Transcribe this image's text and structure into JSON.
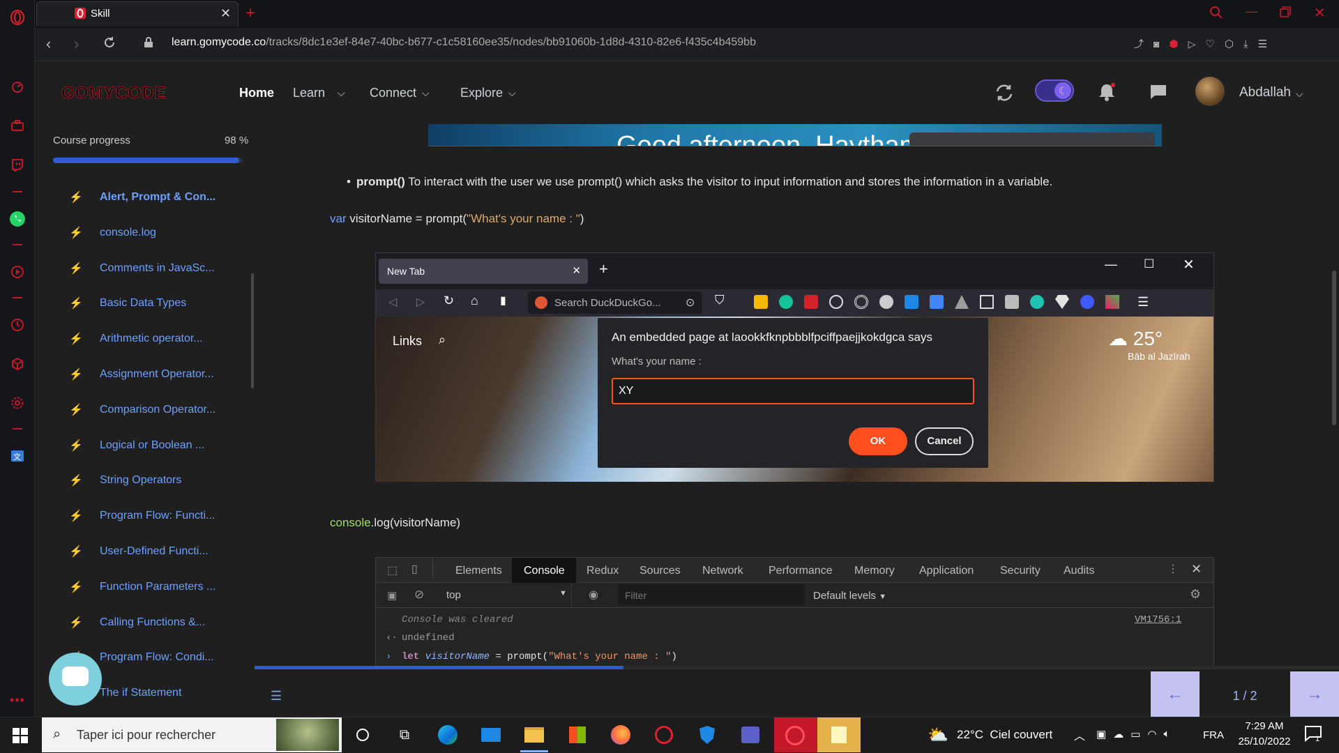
{
  "browser": {
    "tab_title": "Skill",
    "url_domain": "learn.gomycode.co",
    "url_path": "/tracks/8dc1e3ef-84e7-40bc-b677-c1c58160ee35/nodes/bb91060b-1d8d-4310-82e6-f435c4b459bb"
  },
  "header": {
    "logo": "GOMYCODE",
    "nav": [
      {
        "label": "Home"
      },
      {
        "label": "Learn"
      },
      {
        "label": "Connect"
      },
      {
        "label": "Explore"
      }
    ],
    "username": "Abdallah"
  },
  "course": {
    "progress_label": "Course progress",
    "progress_value": "98 %",
    "progress_fraction": 0.98,
    "lessons": [
      "Alert, Prompt & Con...",
      "console.log",
      "Comments in JavaSc...",
      "Basic Data Types",
      "Arithmetic operator...",
      "Assignment Operator...",
      "Comparison Operator...",
      "Logical or Boolean ...",
      "String Operators",
      "Program Flow: Functi...",
      "User-Defined Functi...",
      "Function Parameters ...",
      "Calling Functions &...",
      "Program Flow: Condi...",
      "The if Statement"
    ]
  },
  "content": {
    "banner_text": "Good afternoon, Haytham",
    "bullet_bold": "prompt()",
    "bullet_text": " To interact with the user we use prompt() which asks the visitor to input information and stores the information in a variable.",
    "code1_keyword": "var",
    "code1_rest": " visitorName = prompt(",
    "code1_string": "\"What's your name : \"",
    "code1_end": ")",
    "code2_fn": "console",
    "code2_rest": ".log(visitorName)",
    "inner_browser": {
      "tab": "New Tab",
      "search_placeholder": "Search DuckDuckGo...",
      "links_label": "Links",
      "weather_temp": "25°",
      "weather_place": "Bāb al Jazīrah",
      "dialog_title": "An embedded page at laookkfknpbbblfpciffpaejjkokdgca says",
      "dialog_message": "What's your name :",
      "dialog_input": "XY",
      "ok_label": "OK",
      "cancel_label": "Cancel"
    },
    "devtools": {
      "tabs": [
        "Elements",
        "Console",
        "Redux",
        "Sources",
        "Network",
        "Performance",
        "Memory",
        "Application",
        "Security",
        "Audits"
      ],
      "active_tab": "Console",
      "context": "top",
      "filter_placeholder": "Filter",
      "levels": "Default levels",
      "line1": "Console was cleared",
      "line1_src": "VM1756:1",
      "line2": "undefined",
      "line3_kw": "let",
      "line3_var": " visitorName",
      "line3_eq": " = prompt(",
      "line3_str": "\"What's your name : \"",
      "line3_end": ")"
    }
  },
  "pagination": {
    "page": "1 / 2",
    "prev_icon": "arrow-left-icon",
    "next_icon": "arrow-right-icon",
    "progress_fraction": 0.34
  },
  "taskbar": {
    "search_placeholder": "Taper ici pour rechercher",
    "weather": "22°C  Ciel couvert",
    "lang": "FRA",
    "time": "7:29 AM",
    "date": "25/10/2022",
    "notif_count": "1"
  },
  "colors": {
    "brand_red": "#e0202e",
    "link_blue": "#6ea0ff",
    "progress_blue": "#2f5bd3",
    "ok_orange": "#ff4f1f",
    "pager_lavender": "#c5c3f1"
  }
}
